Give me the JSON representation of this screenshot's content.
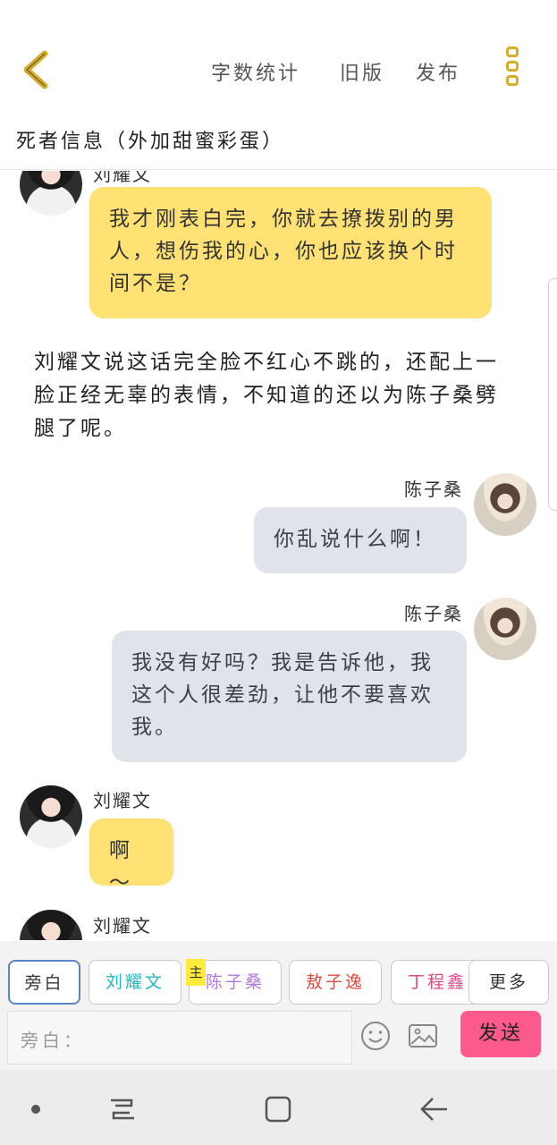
{
  "header": {
    "actions": [
      "字数统计",
      "旧版",
      "发布"
    ],
    "title": "死者信息（外加甜蜜彩蛋）"
  },
  "messages": {
    "m0_name": "刘耀文",
    "m1_text": "我才刚表白完，你就去撩拨别的男人，想伤我的心，你也应该换个时间不是？",
    "narration": "刘耀文说这话完全脸不红心不跳的，还配上一脸正经无辜的表情，不知道的还以为陈子桑劈腿了呢。",
    "m2_name": "陈子桑",
    "m2_text": "你乱说什么啊！",
    "m3_name": "陈子桑",
    "m3_text": "我没有好吗？我是告诉他，我这个人很差劲，让他不要喜欢我。",
    "m4_name": "刘耀文",
    "m4_text": "啊～",
    "m5_name": "刘耀文"
  },
  "roles": {
    "narrator": "旁白",
    "r1": "刘耀文",
    "r2": "陈子桑",
    "r2_badge": "主",
    "r3": "敖子逸",
    "r4": "丁程鑫",
    "more": "更多"
  },
  "role_colors": {
    "r1": "#22b8c4",
    "r2": "#b07ae0",
    "r3": "#e24a3c",
    "r4": "#e0488a"
  },
  "input": {
    "placeholder": "旁白：",
    "send_label": "发送"
  },
  "icons": [
    "back-chevron-icon",
    "more-vertical-icon",
    "emoji-icon",
    "image-icon",
    "nav-dot-icon",
    "recent-apps-icon",
    "home-icon",
    "back-icon"
  ]
}
